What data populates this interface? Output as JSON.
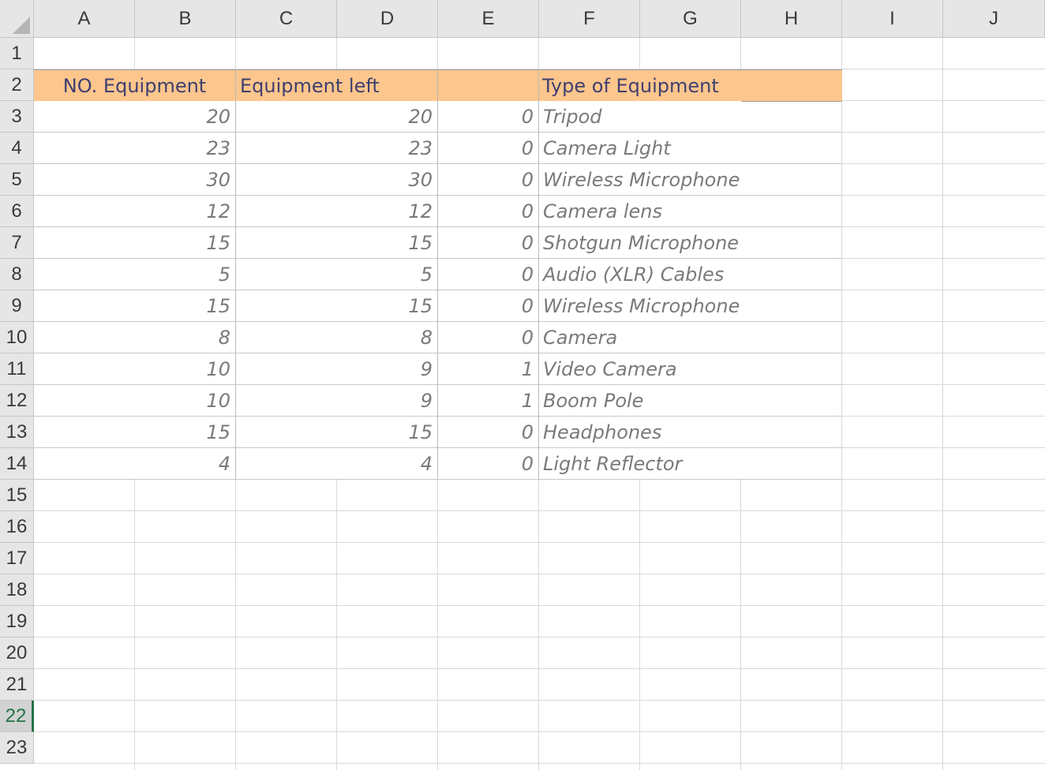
{
  "columns": [
    "A",
    "B",
    "C",
    "D",
    "E",
    "F",
    "G",
    "H",
    "I",
    "J"
  ],
  "rows": [
    "1",
    "2",
    "3",
    "4",
    "5",
    "6",
    "7",
    "8",
    "9",
    "10",
    "11",
    "12",
    "13",
    "14",
    "15",
    "16",
    "17",
    "18",
    "19",
    "20",
    "21",
    "22",
    "23"
  ],
  "active_row": "22",
  "headers": {
    "ab": "NO. Equipment",
    "cd": "Equipment left",
    "e": "",
    "fgh": "Type of Equipment"
  },
  "table": [
    {
      "no": "20",
      "left": "20",
      "diff": "0",
      "type": "Tripod"
    },
    {
      "no": "23",
      "left": "23",
      "diff": "0",
      "type": "Camera Light"
    },
    {
      "no": "30",
      "left": "30",
      "diff": "0",
      "type": "Wireless Microphone"
    },
    {
      "no": "12",
      "left": "12",
      "diff": "0",
      "type": "Camera lens"
    },
    {
      "no": "15",
      "left": "15",
      "diff": "0",
      "type": "Shotgun Microphone"
    },
    {
      "no": "5",
      "left": "5",
      "diff": "0",
      "type": "Audio (XLR) Cables"
    },
    {
      "no": "15",
      "left": "15",
      "diff": "0",
      "type": "Wireless Microphone"
    },
    {
      "no": "8",
      "left": "8",
      "diff": "0",
      "type": "Camera"
    },
    {
      "no": "10",
      "left": "9",
      "diff": "1",
      "type": "Video Camera"
    },
    {
      "no": "10",
      "left": "9",
      "diff": "1",
      "type": "Boom Pole"
    },
    {
      "no": "15",
      "left": "15",
      "diff": "0",
      "type": "Headphones"
    },
    {
      "no": "4",
      "left": "4",
      "diff": "0",
      "type": "Light Reflector"
    }
  ],
  "colors": {
    "header_fill": "#fcc68c",
    "header_text": "#3f3f70",
    "active_row_accent": "#217346"
  }
}
